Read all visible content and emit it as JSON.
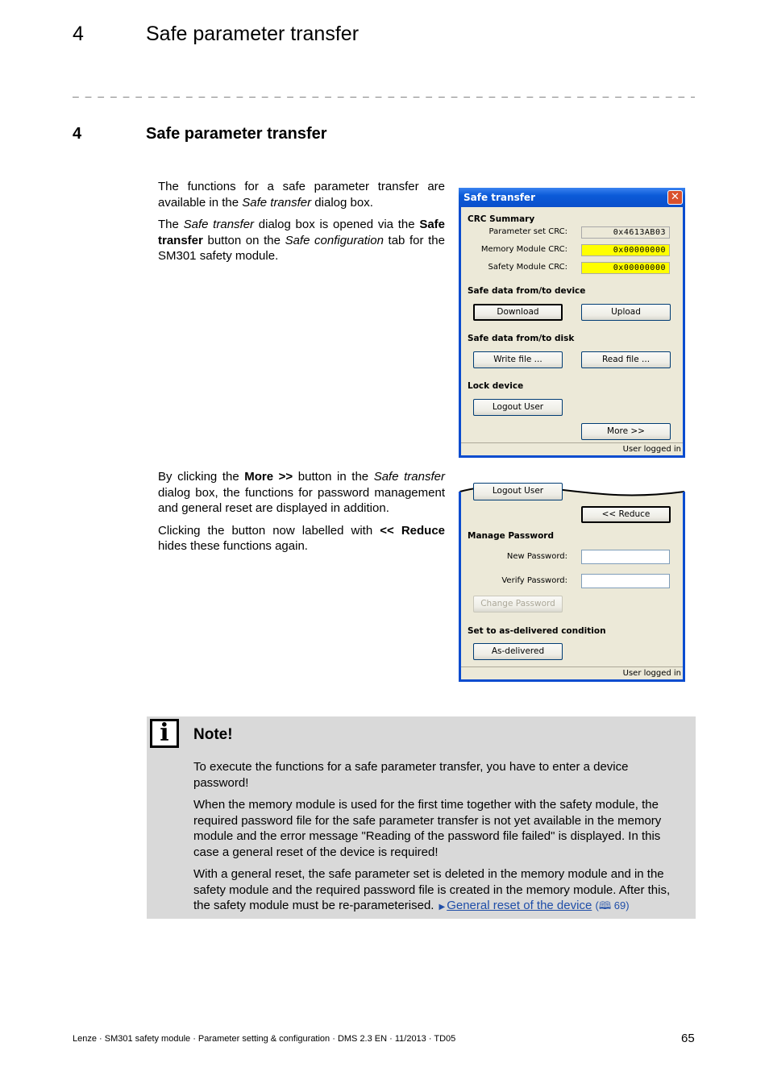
{
  "header": {
    "chapter_number": "4",
    "chapter_title": "Safe parameter transfer"
  },
  "section": {
    "number": "4",
    "title": "Safe parameter transfer"
  },
  "intro": {
    "p1_a": "The functions for a safe parameter transfer are available in the ",
    "p1_i": "Safe transfer",
    "p1_b": " dialog box.",
    "p2_a": "The ",
    "p2_i1": "Safe transfer",
    "p2_b": " dialog box is opened via the ",
    "p2_bold": "Safe transfer",
    "p2_c": " button on the ",
    "p2_i2": "Safe configuration",
    "p2_d": " tab for the SM301 safety module."
  },
  "more": {
    "p1_a": "By clicking the ",
    "p1_bold": "More >>",
    "p1_b": " button in the ",
    "p1_i": "Safe transfer",
    "p1_c": " dialog box, the functions for password management and general reset are displayed in addition.",
    "p2_a": "Clicking the button now labelled with ",
    "p2_bold": "<< Reduce",
    "p2_b": " hides these functions again."
  },
  "dialog1": {
    "title": "Safe transfer",
    "crc_group": "CRC Summary",
    "crc_rows": [
      {
        "label": "Parameter set CRC:",
        "value": "0x4613AB03",
        "highlight": false
      },
      {
        "label": "Memory Module CRC:",
        "value": "0x00000000",
        "highlight": true
      },
      {
        "label": "Safety Module CRC:",
        "value": "0x00000000",
        "highlight": true
      }
    ],
    "device_group": "Safe data from/to device",
    "download": "Download",
    "upload": "Upload",
    "disk_group": "Safe data from/to disk",
    "write_file": "Write file ...",
    "read_file": "Read file ...",
    "lock_group": "Lock device",
    "logout": "Logout User",
    "more": "More >>",
    "status": "User logged in"
  },
  "dialog2": {
    "logout": "Logout User",
    "reduce": "<< Reduce",
    "password_group": "Manage Password",
    "new_password_label": "New Password:",
    "new_password_value": "",
    "verify_password_label": "Verify Password:",
    "verify_password_value": "",
    "change_password": "Change Password",
    "delivered_group": "Set to as-delivered condition",
    "as_delivered": "As-delivered",
    "status": "User logged in"
  },
  "note": {
    "title": "Note!",
    "p1": "To execute the functions for a safe parameter transfer, you have to enter a device password!",
    "p2": "When the memory module is used for the first time together with the safety module, the required password file for the safe parameter transfer is not yet available in the memory module and the error message \"Reading of the password file failed\" is displayed. In this case a general reset of the device is required!",
    "p3": "With a general reset, the safe parameter set is deleted in the memory module and in the safety module and the required password file is created in the memory module. After this, the safety module must be re-parameterised.",
    "link_text": "General reset of the device",
    "link_page": "69"
  },
  "footer": {
    "text": "Lenze · SM301 safety module · Parameter setting & configuration · DMS 2.3 EN · 11/2013 · TD05",
    "page": "65"
  }
}
